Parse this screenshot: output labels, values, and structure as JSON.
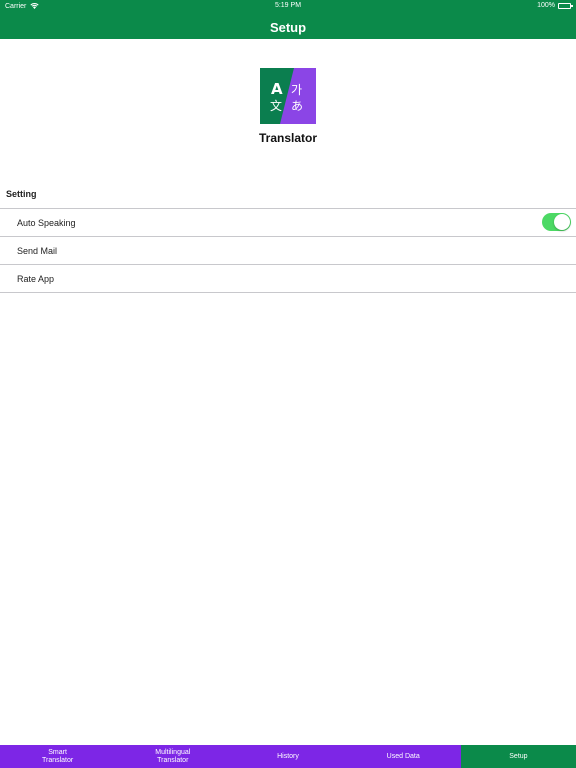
{
  "status_bar": {
    "carrier": "Carrier",
    "time": "5:19 PM",
    "battery": "100%"
  },
  "nav": {
    "title": "Setup"
  },
  "app": {
    "logo_glyphs": [
      "A",
      "가",
      "文",
      "あ"
    ],
    "name": "Translator"
  },
  "settings": {
    "section_title": "Setting",
    "rows": [
      {
        "label": "Auto Speaking",
        "toggle": true
      },
      {
        "label": "Send Mail"
      },
      {
        "label": "Rate App"
      }
    ]
  },
  "tabs": [
    {
      "label": "Smart\nTranslator",
      "active": false
    },
    {
      "label": "Multilingual\nTranslator",
      "active": false
    },
    {
      "label": "History",
      "active": false
    },
    {
      "label": "Used Data",
      "active": false
    },
    {
      "label": "Setup",
      "active": true
    }
  ],
  "colors": {
    "header_green": "#0b8a4a",
    "tabbar_purple": "#7d26e6",
    "toggle_on": "#4cd964",
    "logo_green": "#0b7e4f",
    "logo_purple": "#8b45e6"
  }
}
